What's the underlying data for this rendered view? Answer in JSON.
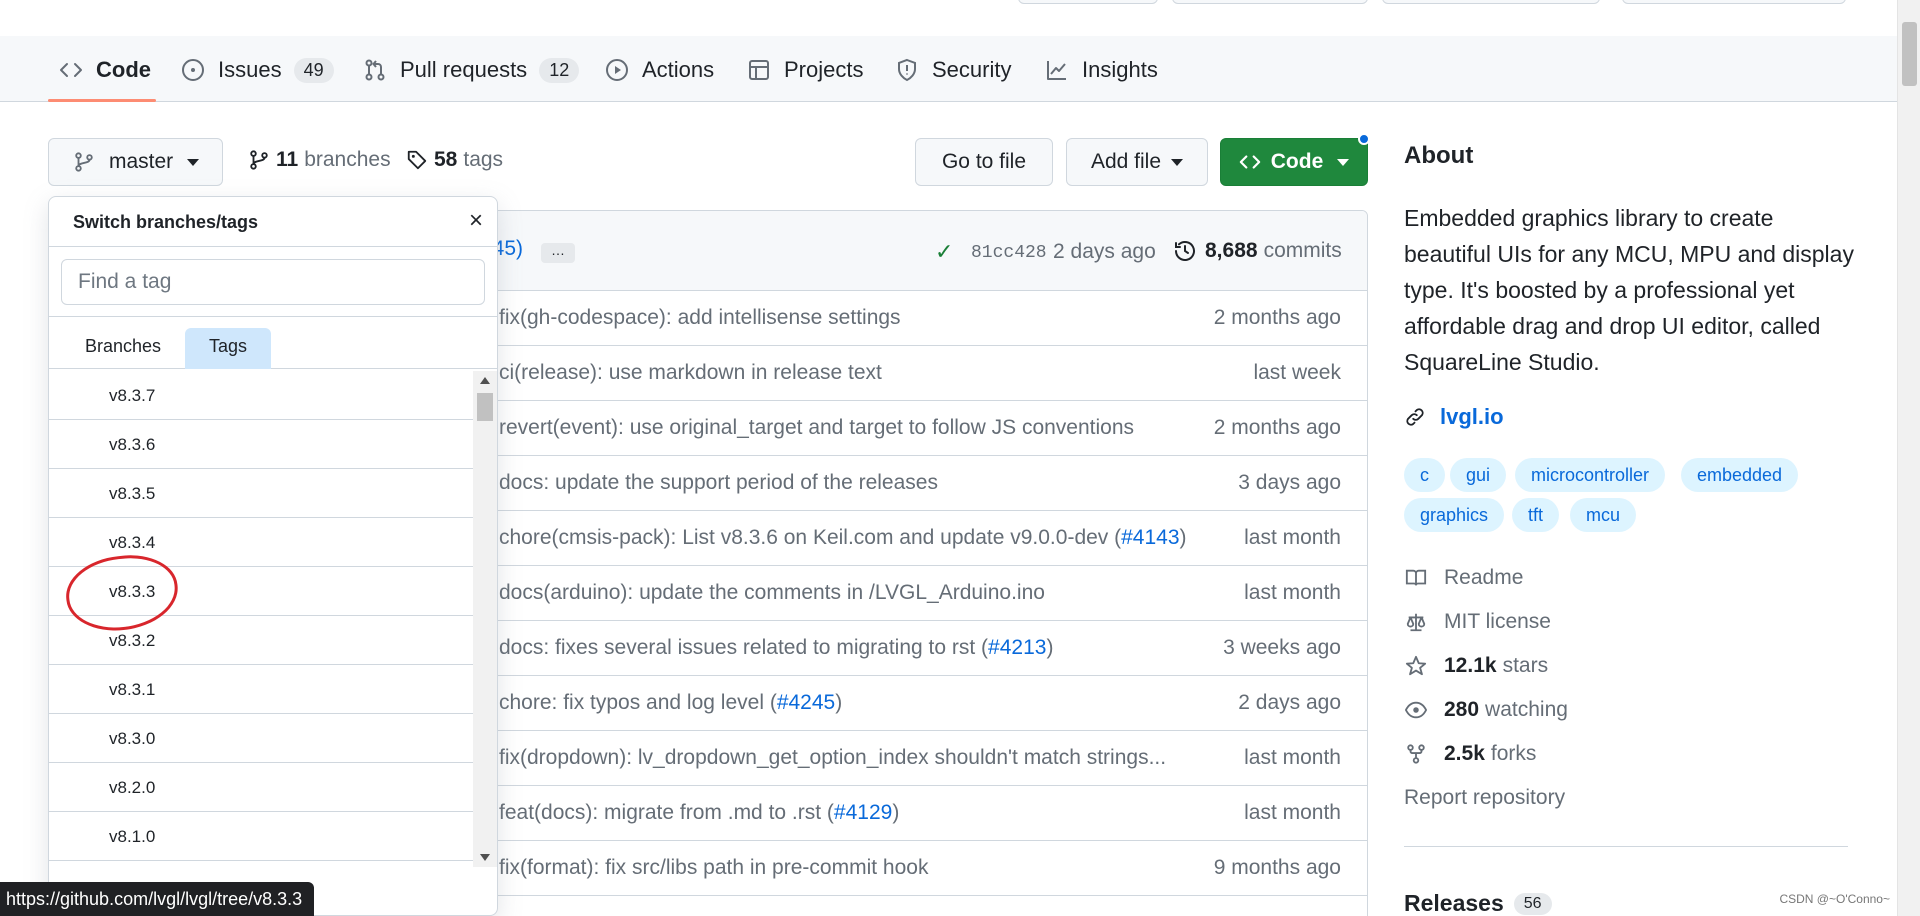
{
  "repo_nav": {
    "tabs": [
      {
        "label": "Code",
        "icon": "code-icon"
      },
      {
        "label": "Issues",
        "count": "49",
        "icon": "issue-opened-icon"
      },
      {
        "label": "Pull requests",
        "count": "12",
        "icon": "git-pull-request-icon"
      },
      {
        "label": "Actions",
        "icon": "play-icon"
      },
      {
        "label": "Projects",
        "icon": "table-icon"
      },
      {
        "label": "Security",
        "icon": "shield-icon"
      },
      {
        "label": "Insights",
        "icon": "graph-icon"
      }
    ]
  },
  "branch_bar": {
    "branch": "master",
    "branches_count": "11",
    "branches_label": "branches",
    "tags_count": "58",
    "tags_label": "tags",
    "go_to_file": "Go to file",
    "add_file": "Add file",
    "code_button": "Code"
  },
  "latest_commit": {
    "pr_fragment": "245)",
    "ellipsis": "…",
    "sha": "81cc428",
    "time": "2 days ago",
    "commits_count": "8,688",
    "commits_label": "commits"
  },
  "files": [
    {
      "message": "fix(gh-codespace): add intellisense settings",
      "time": "2 months ago"
    },
    {
      "message": "ci(release): use markdown in release text",
      "time": "last week"
    },
    {
      "message": "revert(event): use original_target and target to follow JS conventions",
      "time": "2 months ago"
    },
    {
      "message": "docs: update the support period of the releases",
      "time": "3 days ago"
    },
    {
      "message": "chore(cmsis-pack): List v8.3.6 on Keil.com and update v9.0.0-dev (",
      "link": "#4143",
      "suffix": ")",
      "time": "last month"
    },
    {
      "message": "docs(arduino): update the comments in /LVGL_Arduino.ino",
      "time": "last month"
    },
    {
      "message": "docs: fixes several issues related to migrating to rst (",
      "link": "#4213",
      "suffix": ")",
      "time": "3 weeks ago"
    },
    {
      "message": "chore: fix typos and log level (",
      "link": "#4245",
      "suffix": ")",
      "time": "2 days ago"
    },
    {
      "message": "fix(dropdown): lv_dropdown_get_option_index shouldn't match strings...",
      "time": "last month"
    },
    {
      "message": "feat(docs): migrate from .md to .rst (",
      "link": "#4129",
      "suffix": ")",
      "time": "last month"
    },
    {
      "message": "fix(format): fix src/libs path in pre-commit hook",
      "time": "9 months ago"
    }
  ],
  "dropdown": {
    "title": "Switch branches/tags",
    "close": "×",
    "filter_placeholder": "Find a tag",
    "tab_branches": "Branches",
    "tab_tags": "Tags",
    "tags": [
      "v8.3.7",
      "v8.3.6",
      "v8.3.5",
      "v8.3.4",
      "v8.3.3",
      "v8.3.2",
      "v8.3.1",
      "v8.3.0",
      "v8.2.0",
      "v8.1.0"
    ]
  },
  "about": {
    "heading": "About",
    "description": "Embedded graphics library to create beautiful UIs for any MCU, MPU and display type. It's boosted by a professional yet affordable drag and drop UI editor, called SquareLine Studio.",
    "website": "lvgl.io",
    "topics": [
      "c",
      "gui",
      "microcontroller",
      "embedded",
      "graphics",
      "tft",
      "mcu"
    ],
    "readme": "Readme",
    "license": "MIT license",
    "stars_count": "12.1k",
    "stars_label": "stars",
    "watching_count": "280",
    "watching_label": "watching",
    "forks_count": "2.5k",
    "forks_label": "forks",
    "report": "Report repository",
    "releases_label": "Releases",
    "releases_count": "56"
  },
  "status_bar_url": "https://github.com/lvgl/lvgl/tree/v8.3.3",
  "watermark": "CSDN @~O'Conno~",
  "colors": {
    "accent_blue": "#0969da",
    "green_button": "#1f883d",
    "active_tab_underline": "#fd8c73",
    "annotation_red": "#d8262c"
  }
}
